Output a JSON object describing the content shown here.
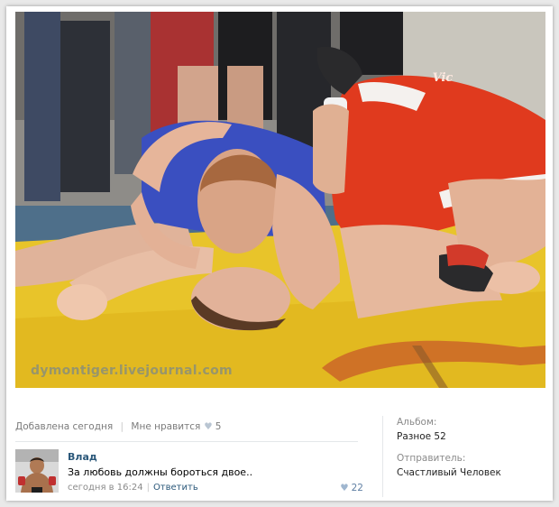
{
  "photo": {
    "watermark": "dymontiger.livejournal.com",
    "logo_badge": "Vic"
  },
  "post": {
    "added": "Добавлена сегодня",
    "like_label": "Мне нравится",
    "like_count": "5"
  },
  "comment": {
    "author": "Влад",
    "text": "За любовь должны бороться двое..",
    "time": "сегодня в 16:24",
    "reply_label": "Ответить",
    "likes": "22"
  },
  "sidebar": {
    "album_label": "Альбом:",
    "album_value": "Разное 52",
    "sender_label": "Отправитель:",
    "sender_value": "Счастливый Человек"
  },
  "colors": {
    "link": "#2b587a",
    "mat_yellow": "#e8c42a",
    "singlet_red": "#e03a1e",
    "singlet_blue": "#3a4fc0"
  }
}
